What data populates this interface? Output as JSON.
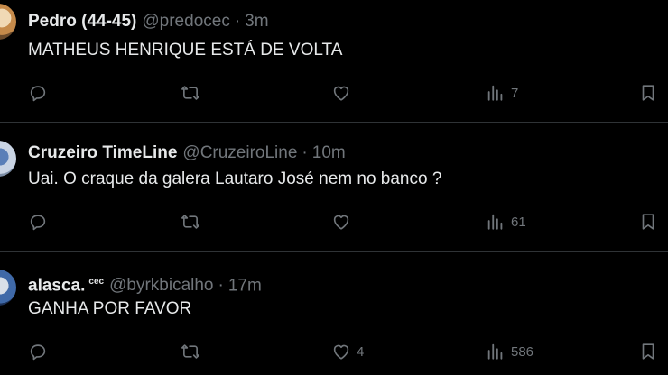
{
  "colors": {
    "background": "#000000",
    "text_primary": "#e7e9ea",
    "text_secondary": "#71767b",
    "divider": "#2f3336"
  },
  "tweets": [
    {
      "name": "Pedro (44-45)",
      "badge": "",
      "handle": "@predocec",
      "dot": "·",
      "time": "3m",
      "text": "MATHEUS HENRIQUE ESTÁ DE VOLTA",
      "likes": "",
      "views": "7"
    },
    {
      "name": "Cruzeiro TimeLine",
      "badge": "",
      "handle": "@CruzeiroLine",
      "dot": "·",
      "time": "10m",
      "text": "Uai. O craque da galera Lautaro José nem no banco ?",
      "likes": "",
      "views": "61"
    },
    {
      "name": "alasca.",
      "badge": "cec",
      "handle": "@byrkbicalho",
      "dot": "·",
      "time": "17m",
      "text": "GANHA POR FAVOR",
      "likes": "4",
      "views": "586"
    }
  ],
  "icons": {
    "reply": "reply-icon",
    "repost": "repost-icon",
    "like": "heart-icon",
    "views": "views-icon",
    "bookmark": "bookmark-icon"
  }
}
